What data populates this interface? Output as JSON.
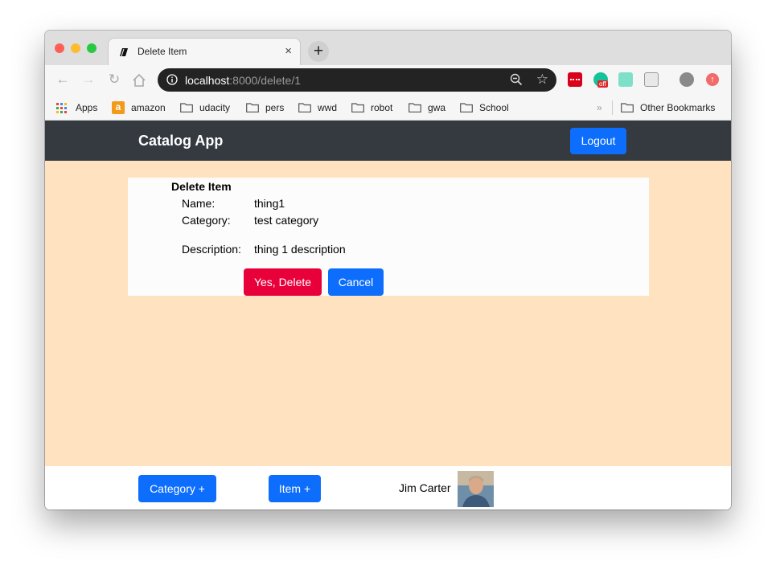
{
  "browser": {
    "tab_title": "Delete Item",
    "new_tab_symbol": "+",
    "close_symbol": "×",
    "url_host": "localhost",
    "url_path": ":8000/delete/1",
    "extensions": {
      "grammarly_badge": "off"
    },
    "bookmarks": {
      "apps": "Apps",
      "items": [
        "amazon",
        "udacity",
        "pers",
        "wwd",
        "robot",
        "gwa",
        "School"
      ],
      "overflow": "»",
      "other": "Other Bookmarks"
    }
  },
  "navbar": {
    "brand": "Catalog App",
    "logout": "Logout"
  },
  "delete_form": {
    "title": "Delete Item",
    "name_label": "Name:",
    "name_value": "thing1",
    "category_label": "Category:",
    "category_value": "test category",
    "description_label": "Description:",
    "description_value": "thing 1 description",
    "confirm_button": "Yes, Delete",
    "cancel_button": "Cancel"
  },
  "footer": {
    "add_category": "Category +",
    "add_item": "Item +",
    "user_name": "Jim Carter"
  },
  "colors": {
    "navbar_bg": "#343a40",
    "page_bg": "#ffe3c1",
    "primary": "#0d6efd",
    "danger": "#e8003a"
  }
}
